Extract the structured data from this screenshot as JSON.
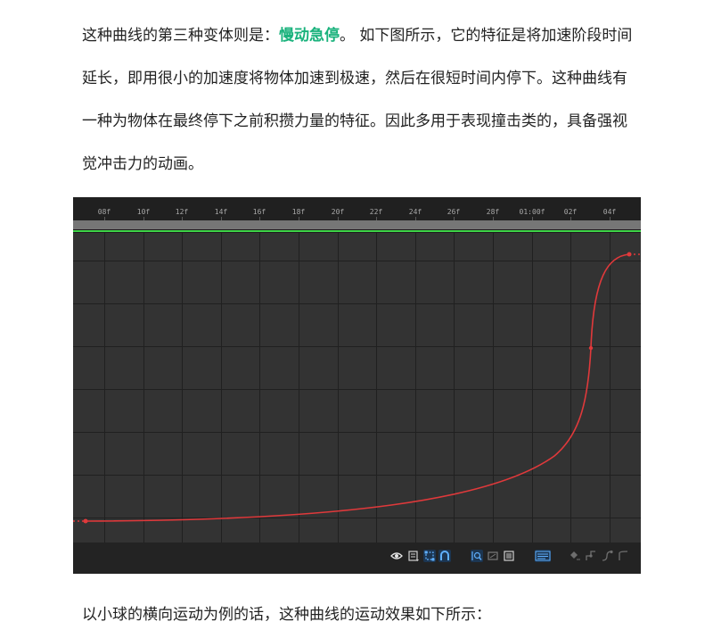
{
  "intro": {
    "text_before": "这种曲线的第三种变体则是：",
    "highlight": "慢动急停",
    "text_after": "。 如下图所示，它的特征是将加速阶段时间延长，即用很小的加速度将物体加速到极速，然后在很短时间内停下。这种曲线有一种为物体在最终停下之前积攒力量的特征。因此多用于表现撞击类的，具备强视觉冲击力的动画。"
  },
  "outro": {
    "text": "以小球的横向运动为例的话，这种曲线的运动效果如下所示："
  },
  "graph_editor": {
    "ruler_labels": [
      "08f",
      "10f",
      "12f",
      "14f",
      "16f",
      "18f",
      "20f",
      "22f",
      "24f",
      "26f",
      "28f",
      "01:00f",
      "02f",
      "04f"
    ],
    "work_area_color": "#3ed447",
    "curve_color": "#e0393b",
    "toolbar_icons": [
      "eye-icon",
      "graph-type-icon",
      "transform-box-icon",
      "snap-icon",
      "fit-selection-icon",
      "fit-all-icon",
      "auto-zoom-icon",
      "edit-graph-icon",
      "convert-keyframe-icon",
      "convert-hold-icon",
      "easy-ease-icon",
      "easy-ease-in-icon"
    ]
  }
}
